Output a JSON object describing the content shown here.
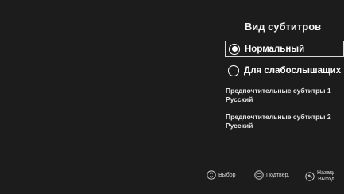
{
  "panel": {
    "title": "Вид субтитров",
    "options": [
      {
        "label": "Нормальный",
        "selected": true
      },
      {
        "label": "Для слабослышащих",
        "selected": false
      }
    ],
    "preferred": [
      {
        "label": "Предпочтительные субтитры 1",
        "value": "Русский"
      },
      {
        "label": "Предпочтительные субтитры 2",
        "value": "Русский"
      }
    ]
  },
  "hints": {
    "select": {
      "icon": "up-down-icon",
      "label": "Выбор"
    },
    "confirm": {
      "icon": "enter-icon",
      "label": "Подтвер."
    },
    "back": {
      "icon": "back-arrow-icon",
      "label_line1": "Назад/",
      "label_line2": "Выход"
    }
  },
  "colors": {
    "background": "#1c1c1c",
    "text": "#ffffff",
    "selection_border": "#d8d8d8"
  }
}
